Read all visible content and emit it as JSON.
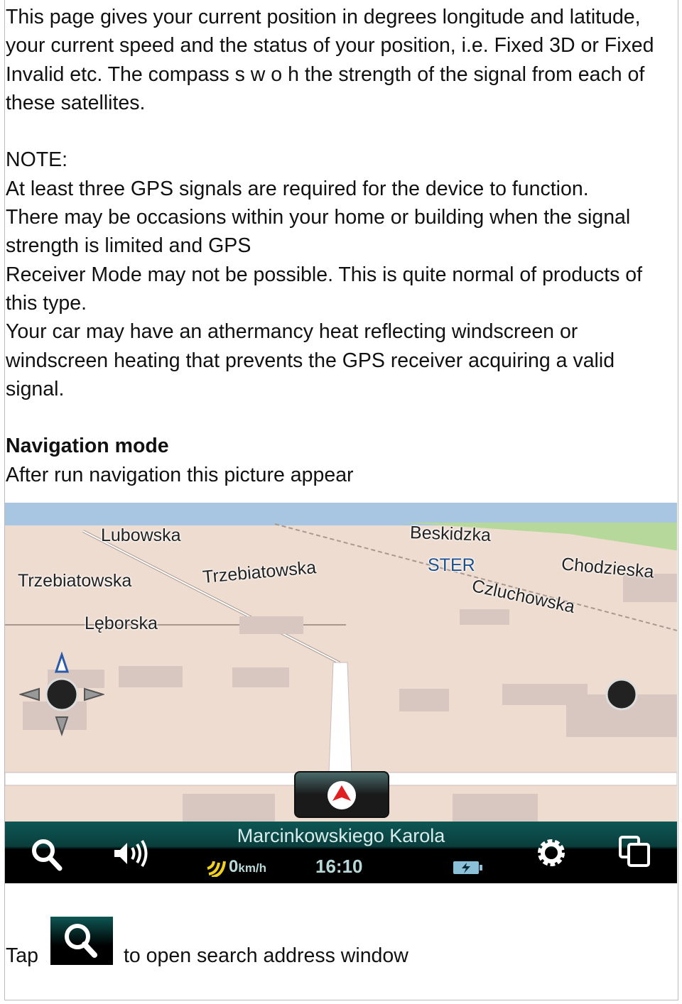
{
  "paragraphs": {
    "intro": "This page gives your current position in degrees longitude and latitude, your current speed and the status of your position, i.e. Fixed 3D or Fixed Invalid etc. The compass s w o h the strength of the signal from each of these satellites.",
    "note_heading": "NOTE:",
    "note_1": "At least three GPS signals are required for the device to function.",
    "note_2": "There may be occasions within your home or building when the signal strength is limited and GPS",
    "note_3": "Receiver Mode may not be possible. This is quite normal of products of this type.",
    "note_4": "Your car may have an athermancy heat reflecting windscreen or windscreen heating that prevents the GPS receiver acquiring a valid signal.",
    "nav_heading": "Navigation mode",
    "nav_text": "After run navigation this picture appear"
  },
  "map": {
    "streets": [
      "Lubowska",
      "Trzebiatowska",
      "Trzebiatowska",
      "Lęborska",
      "Beskidzka",
      "STER",
      "Chodzieska",
      "Czluchowska"
    ],
    "bottom_bar": {
      "street_name": "Marcinkowskiego Karola",
      "speed_value": "0",
      "speed_unit": "km/h",
      "time": "16:10",
      "icons": [
        "search-icon",
        "volume-icon",
        "gps-signal-icon",
        "battery-charging-icon",
        "gear-icon",
        "windows-icon"
      ]
    },
    "colors": {
      "land": "#eedcd0",
      "sky": "#a8c6e2",
      "bar": "#0d5755",
      "poi": "#1d4f8a"
    }
  },
  "footer": {
    "tap_label": "Tap",
    "tap_text": "to open search address window"
  }
}
